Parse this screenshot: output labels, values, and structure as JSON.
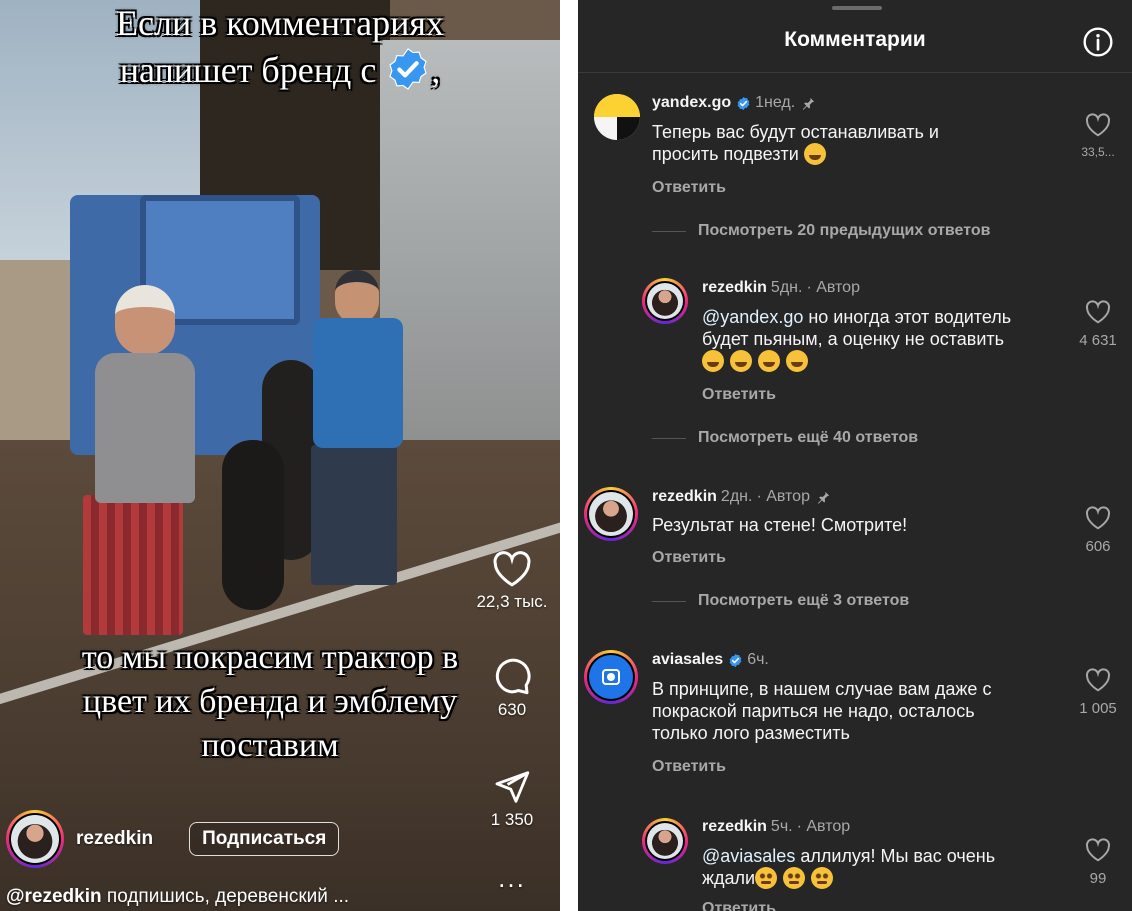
{
  "video": {
    "caption_top_line1": "Если в комментариях",
    "caption_top_line2": "напишет бренд с",
    "caption_top_comma": ",",
    "caption_bottom_line1": "то мы покрасим трактор в",
    "caption_bottom_line2": "цвет их бренда и эмблему",
    "caption_bottom_line3": "поставим",
    "likes": "22,3 тыс.",
    "comments": "630",
    "shares": "1 350",
    "more": "...",
    "author": "rezedkin",
    "subscribe_label": "Подписаться",
    "description_user": "@rezedkin",
    "description_text": " подпишись, деревенский ..."
  },
  "panel": {
    "title": "Комментарии",
    "info_icon": "info-icon",
    "comments": [
      {
        "user": "yandex.go",
        "verified": true,
        "time": "1нед.",
        "pinned": true,
        "text_line1": "Теперь вас будут останавливать и",
        "text_line2": "просить подвезти",
        "likes": "33,5...",
        "reply": "Ответить"
      },
      {
        "thread": "Посмотреть 20 предыдущих ответов"
      },
      {
        "user": "rezedkin",
        "time": "5дн.",
        "role": "· Автор",
        "mention": "@yandex.go",
        "text_line1": " но иногда этот водитель",
        "text_line2": "будет пьяным, а оценку не оставить",
        "likes": "4 631",
        "reply": "Ответить"
      },
      {
        "thread": "Посмотреть ещё 40 ответов"
      },
      {
        "user": "rezedkin",
        "time": "2дн.",
        "role": "· Автор",
        "pinned": true,
        "text_line1": "Результат на стене! Смотрите!",
        "likes": "606",
        "reply": "Ответить"
      },
      {
        "thread": "Посмотреть ещё 3 ответов"
      },
      {
        "user": "aviasales",
        "verified": true,
        "time": "6ч.",
        "text_line1": "В принципе, в нашем случае вам даже с",
        "text_line2": "покраской париться не надо, осталось",
        "text_line3": "только лого разместить",
        "likes": "1 005",
        "reply": "Ответить"
      },
      {
        "user": "rezedkin",
        "time": "5ч.",
        "role": "· Автор",
        "mention": "@aviasales",
        "text_line1": " аллилуя! Мы вас очень",
        "text_line2": "ждали",
        "likes": "99",
        "reply": "Ответить"
      }
    ]
  },
  "colors": {
    "panel_bg": "#262626",
    "verified_blue": "#3897f0",
    "muted_text": "#a8a8a8"
  }
}
